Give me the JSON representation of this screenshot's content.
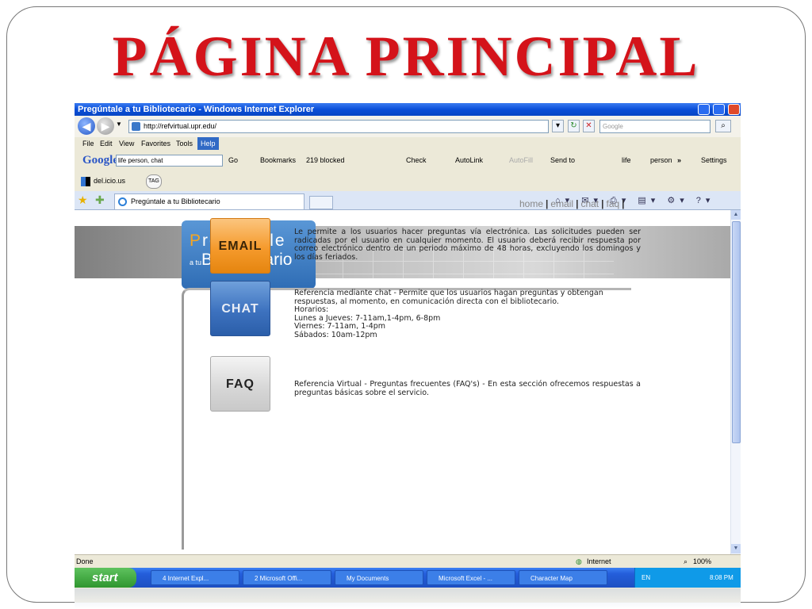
{
  "slide": {
    "title": "PÁGINA PRINCIPAL"
  },
  "window": {
    "title": "Pregúntale a tu Bibliotecario - Windows Internet Explorer"
  },
  "address_bar": {
    "url": "http://refvirtual.upr.edu/",
    "search_placeholder": "Google"
  },
  "menu": [
    "File",
    "Edit",
    "View",
    "Favorites",
    "Tools",
    "Help"
  ],
  "google_toolbar": {
    "logo": "Google",
    "query": "life person, chat",
    "go": "Go",
    "bookmarks": "Bookmarks",
    "blocked": "219 blocked",
    "check": "Check",
    "autolink": "AutoLink",
    "autofill": "AutoFill",
    "send_to": "Send to",
    "life": "life",
    "person": "person",
    "more": "»",
    "settings": "Settings"
  },
  "delicious_bar": {
    "label": "del.icio.us",
    "tag": "TAG"
  },
  "tab": {
    "title": "Pregúntale a tu Bibliotecario"
  },
  "site": {
    "logo_top": "regúntale",
    "logo_q": "P",
    "logo_small": "a tu",
    "logo_bottom": "Bibliotecario",
    "nav": [
      "home",
      "email",
      "chat",
      "faq"
    ],
    "services": {
      "email": {
        "button": "EMAIL",
        "description": "Le permite a los usuarios hacer preguntas vía electrónica. Las solicitudes pueden ser radicadas por el usuario en cualquier momento. El usuario deberá recibir respuesta por correo electrónico dentro de un periodo máximo de 48 horas, excluyendo los domingos y los días feriados."
      },
      "chat": {
        "button": "CHAT",
        "lines": [
          "Referencia mediante chat - Permite que los usuarios hagan preguntas y obtengan respuestas, al momento, en comunicación directa con el bibliotecario.",
          "Horarios:",
          "Lunes a Jueves: 7-11am,1-4pm, 6-8pm",
          "Viernes: 7-11am, 1-4pm",
          "Sábados: 10am-12pm"
        ]
      },
      "faq": {
        "button": "FAQ",
        "description": "Referencia Virtual - Preguntas frecuentes (FAQ's) - En esta sección ofrecemos respuestas a preguntas básicas sobre el servicio."
      }
    }
  },
  "status_bar": {
    "left": "Done",
    "zone": "Internet",
    "zoom": "100%"
  },
  "taskbar": {
    "start": "start",
    "tasks": [
      "4 Internet Expl...",
      "2 Microsoft Offi...",
      "My Documents",
      "Microsoft Excel - ...",
      "Character Map"
    ],
    "lang": "EN",
    "clock": "8:08 PM"
  }
}
